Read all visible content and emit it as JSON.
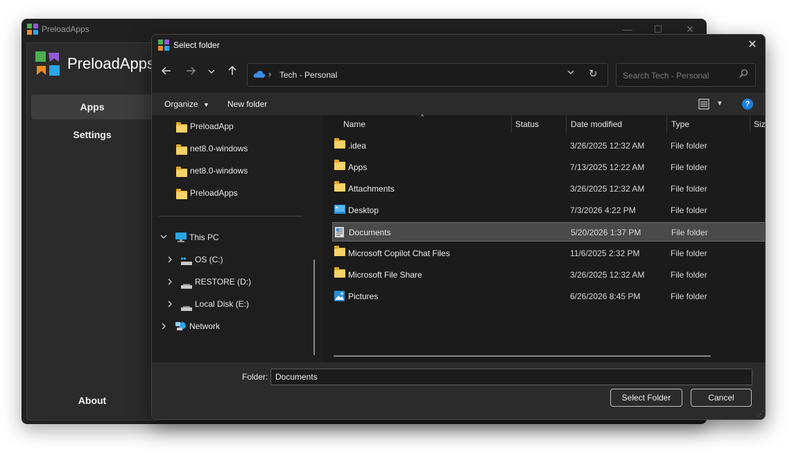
{
  "app": {
    "title": "PreloadApps",
    "brand": "PreloadApps",
    "nav": {
      "apps": "Apps",
      "settings": "Settings",
      "about": "About"
    },
    "window_controls": {
      "minimize": "—",
      "maximize": "☐",
      "close": "✕"
    }
  },
  "dialog": {
    "title": "Select folder",
    "close": "✕",
    "address": {
      "separator": "›",
      "path": "Tech - Personal",
      "dropdown": "⌄",
      "refresh": "↻"
    },
    "search": {
      "placeholder": "Search Tech - Personal"
    },
    "toolbar": {
      "organize": "Organize",
      "new_folder": "New folder",
      "help": "?"
    },
    "tree": {
      "items": [
        {
          "label": "PreloadApp"
        },
        {
          "label": "net8.0-windows"
        },
        {
          "label": "net8.0-windows"
        },
        {
          "label": "PreloadApps"
        }
      ],
      "this_pc": "This PC",
      "drives": [
        {
          "label": "OS (C:)"
        },
        {
          "label": "RESTORE (D:)"
        },
        {
          "label": "Local Disk (E:)"
        }
      ],
      "network": "Network"
    },
    "columns": {
      "name": "Name",
      "status": "Status",
      "date": "Date modified",
      "type": "Type",
      "size": "Siz"
    },
    "rows": [
      {
        "name": ".idea",
        "date": "3/26/2025 12:32 AM",
        "type": "File folder",
        "icon": "folder-icon"
      },
      {
        "name": "Apps",
        "date": "7/13/2025 12:22 AM",
        "type": "File folder",
        "icon": "folder-icon"
      },
      {
        "name": "Attachments",
        "date": "3/26/2025 12:32 AM",
        "type": "File folder",
        "icon": "folder-icon"
      },
      {
        "name": "Desktop",
        "date": "7/3/2026 4:22 PM",
        "type": "File folder",
        "icon": "desktop-icon"
      },
      {
        "name": "Documents",
        "date": "5/20/2026 1:37 PM",
        "type": "File folder",
        "icon": "documents-icon",
        "selected": true
      },
      {
        "name": "Microsoft Copilot Chat Files",
        "date": "11/6/2025 2:32 PM",
        "type": "File folder",
        "icon": "folder-icon"
      },
      {
        "name": "Microsoft File Share",
        "date": "3/26/2025 12:32 AM",
        "type": "File folder",
        "icon": "folder-icon"
      },
      {
        "name": "Pictures",
        "date": "6/26/2026 8:45 PM",
        "type": "File folder",
        "icon": "pictures-icon"
      }
    ],
    "folder_label": "Folder:",
    "folder_value": "Documents",
    "select_button": "Select Folder",
    "cancel_button": "Cancel"
  },
  "colors": {
    "accent": "#1a7fde",
    "background": "#202020",
    "folder": "#f3c74c"
  }
}
